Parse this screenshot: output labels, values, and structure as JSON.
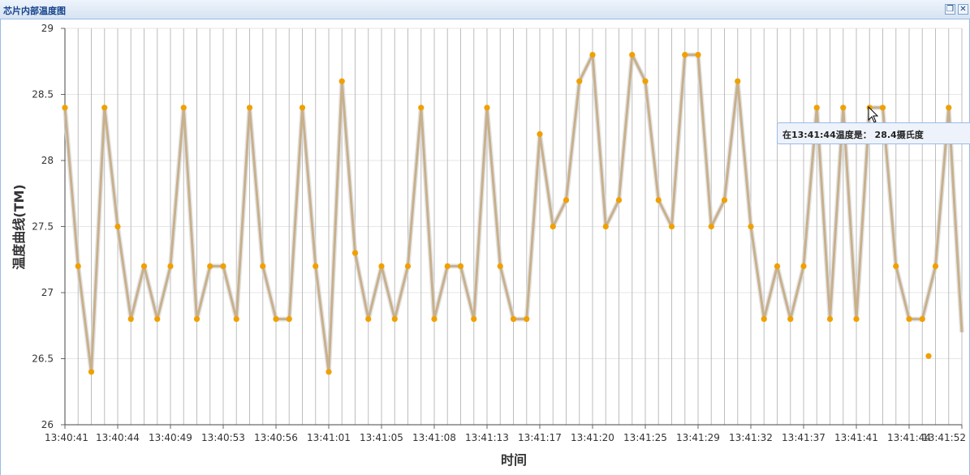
{
  "window": {
    "title": "芯片内部温度图",
    "restore_icon": "restore-icon",
    "close_icon": "close-icon"
  },
  "tooltip": {
    "text": "在13:41:44温度是：  28.4摄氏度"
  },
  "chart_data": {
    "type": "line",
    "xlabel": "时间",
    "ylabel": "温度曲线(TM)",
    "ylim": [
      26,
      29
    ],
    "yticks": [
      "26",
      "26.5",
      "27",
      "27.5",
      "28",
      "28.5",
      "29"
    ],
    "xtick_labels": [
      "13:40:41",
      "13:40:44",
      "13:40:49",
      "13:40:53",
      "13:40:56",
      "13:41:01",
      "13:41:05",
      "13:41:08",
      "13:41:13",
      "13:41:17",
      "13:41:20",
      "13:41:25",
      "13:41:29",
      "13:41:32",
      "13:41:37",
      "13:41:41",
      "13:41:44",
      "13:41:52"
    ],
    "grid": true,
    "line_color": "#c8b08c",
    "marker_color": "#f0a000",
    "series": [
      {
        "values": [
          28.4,
          27.2,
          26.4,
          28.4,
          27.5,
          26.8,
          27.2,
          26.8,
          27.2,
          28.4,
          26.8,
          27.2,
          27.2,
          26.8,
          28.4,
          27.2,
          26.8,
          26.8,
          28.4,
          27.2,
          26.4,
          28.6,
          27.3,
          26.8,
          27.2,
          26.8,
          27.2,
          28.4,
          26.8,
          27.2,
          27.2,
          26.8,
          28.4,
          27.2,
          26.8,
          26.8,
          28.2,
          27.5,
          27.7,
          28.6,
          28.8,
          27.5,
          27.7,
          28.8,
          28.6,
          27.7,
          27.5,
          28.8,
          28.8,
          27.5,
          27.7,
          28.6,
          27.5,
          26.8,
          27.2,
          26.8,
          27.2,
          28.4,
          26.8,
          28.4,
          26.8,
          28.4,
          28.4,
          27.2,
          26.8,
          26.8,
          27.2,
          28.4,
          26.7
        ]
      }
    ],
    "isolated_points": [
      26.52
    ]
  }
}
